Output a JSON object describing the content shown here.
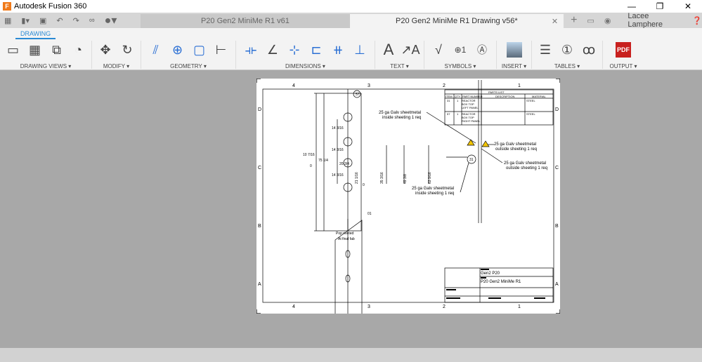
{
  "app": {
    "title": "Autodesk Fusion 360",
    "logo": "F"
  },
  "window": {
    "minimize": "—",
    "restore": "❐",
    "close": "✕"
  },
  "tabs": [
    {
      "label": "P20 Gen2 MiniMe R1 v61"
    },
    {
      "label": "P20 Gen2 MiniMe R1 Drawing v56*"
    }
  ],
  "user": {
    "name": "Lacee Lamphere"
  },
  "toolbar": {
    "active_tab": "DRAWING",
    "groups": [
      {
        "label": "DRAWING VIEWS ▾"
      },
      {
        "label": "MODIFY ▾"
      },
      {
        "label": "GEOMETRY ▾"
      },
      {
        "label": "DIMENSIONS ▾"
      },
      {
        "label": "TEXT ▾"
      },
      {
        "label": "SYMBOLS ▾"
      },
      {
        "label": "INSERT ▾"
      },
      {
        "label": "TABLES ▾"
      },
      {
        "label": "OUTPUT ▾"
      }
    ]
  },
  "drawing": {
    "zones_top": [
      "4",
      "3",
      "2",
      "1"
    ],
    "zones_side": [
      "D",
      "C",
      "B",
      "A"
    ],
    "parts_list": {
      "title": "PARTS LIST",
      "headers": [
        "ITEM",
        "QTY",
        "PART NUMBER",
        "DESCRIPTION",
        "MATERIAL"
      ],
      "rows": [
        [
          "31",
          "1",
          "REACTOR BOX TOP LEFT PANEL",
          "",
          "STEEL"
        ],
        [
          "57",
          "1",
          "REACTOR BOX TOP RIGHT PANEL",
          "",
          "STEEL"
        ]
      ]
    },
    "title_block": {
      "line1": "Gen2 P20",
      "line2": "P20 Gen2 MiniMe R1"
    },
    "balloons": [
      "57",
      "31"
    ],
    "notes": [
      "25 ga Galv sheetmetal",
      "inside sheeting 1 req",
      "25 ga Galv sheetmetal",
      "outside sheeting 1 req",
      "25 ga Galv sheetmetal",
      "outside sheeting 1 req",
      "25 ga Galv sheetmetal",
      "inside sheeting 1 req"
    ],
    "dims": [
      "14 3/16",
      "14 3/16",
      "14 3/16",
      "10 7/16",
      "75 1/4",
      "0",
      "20 3/4",
      "21 1/16",
      "35 3/16",
      "49 3/8",
      "63 9/16",
      "0",
      "01"
    ],
    "field_note": [
      "Pop riveted",
      "At final fab"
    ]
  }
}
